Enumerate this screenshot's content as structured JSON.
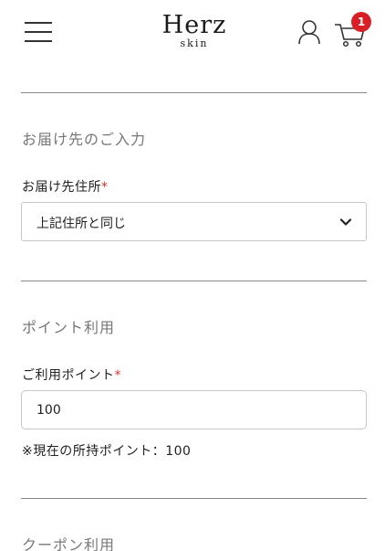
{
  "header": {
    "logo_brand": "Herz",
    "logo_sub": "skin",
    "cart_count": "1",
    "icons": {
      "menu": "hamburger-menu-icon",
      "user": "user-icon",
      "cart": "cart-icon"
    },
    "badge_color": "#d81f26"
  },
  "delivery": {
    "section_title": "お届け先のご入力",
    "label": "お届け先住所",
    "required_mark": "*",
    "selected": "上記住所と同じ"
  },
  "points": {
    "section_title": "ポイント利用",
    "label": "ご利用ポイント",
    "required_mark": "*",
    "value": "100",
    "note": "※現在の所持ポイント：100"
  },
  "coupon": {
    "section_title": "クーポン利用"
  },
  "colors": {
    "required": "#d0342c",
    "section_title": "#777777",
    "border": "#c6c6c6"
  }
}
